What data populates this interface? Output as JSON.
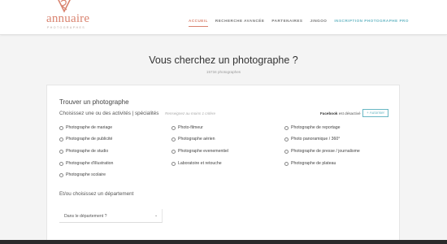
{
  "brand": {
    "name": "annuaire",
    "tagline": "PHOTOGRAPHES",
    "color": "#d9836f"
  },
  "nav": {
    "items": [
      {
        "label": "ACCUEIL",
        "active": true
      },
      {
        "label": "RECHERCHE AVANCÉE"
      },
      {
        "label": "PARTENAIRES"
      },
      {
        "label": "JINGOO"
      },
      {
        "label": "INSCRIPTION PHOTOGRAPHE PRO",
        "accent": true
      }
    ]
  },
  "hero": {
    "title": "Vous cherchez un photographe ?",
    "count": "15734 photographes"
  },
  "search": {
    "title": "Trouver un photographe",
    "activities_label": "Choisissez une ou des activités | spécialités",
    "activities_hint": "Renseignez au moins 1 critère",
    "facebook_name": "Facebook",
    "facebook_status": " est désactivé",
    "facebook_button": "+ Autoriser",
    "options": [
      "Photographe de mariage",
      "Photographe de publicité",
      "Photographe de studio",
      "Photographe d'illustration",
      "Photographe scolaire",
      "Photo-filmeur",
      "Photographe aérien",
      "Photographe evenementiel",
      "Laboratoire et retouche",
      "Photographe de reportage",
      "Photo panoramique / 360°",
      "Photographe de presse / journalisme",
      "Photographe de plateau"
    ],
    "department_label": "Et/ou choisissez un département",
    "department_placeholder": "Dans le département ?"
  }
}
